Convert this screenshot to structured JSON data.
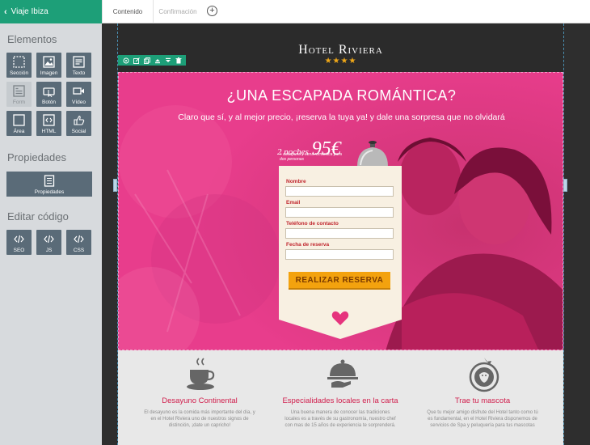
{
  "topbar": {
    "project_label": "Viaje Ibiza",
    "tabs": [
      {
        "label": "Contenido"
      },
      {
        "label": "Confirmación"
      }
    ]
  },
  "sidebar": {
    "elements_title": "Elementos",
    "tools": [
      {
        "label": "Sección",
        "icon": "section-icon"
      },
      {
        "label": "Imagen",
        "icon": "image-icon"
      },
      {
        "label": "Texto",
        "icon": "text-icon"
      },
      {
        "label": "Form",
        "icon": "form-icon"
      },
      {
        "label": "Botón",
        "icon": "button-icon"
      },
      {
        "label": "Vídeo",
        "icon": "video-icon"
      },
      {
        "label": "Área",
        "icon": "area-icon"
      },
      {
        "label": "HTML",
        "icon": "html-icon"
      },
      {
        "label": "Social",
        "icon": "social-icon"
      }
    ],
    "properties_title": "Propiedades",
    "properties_button": "Propiedades",
    "code_title": "Editar código",
    "code_tools": [
      {
        "label": "SEO",
        "icon": "code-icon"
      },
      {
        "label": "JS",
        "icon": "code-icon"
      },
      {
        "label": "CSS",
        "icon": "code-icon"
      }
    ]
  },
  "page": {
    "brand": "Hotel Riviera",
    "stars": "★★★★",
    "hero": {
      "title": "¿UNA ESCAPADA ROMÁNTICA?",
      "subtitle": "Claro que sí, y al mejor precio, ¡reserva la tuya ya! y dale una sorpresa que no olvidará",
      "offer_nights": "2 noches",
      "offer_price": "95€",
      "offer_desc": "+ desayuno y cena romántica para dos personas",
      "form": {
        "fields": [
          {
            "label": "Nombre",
            "value": ""
          },
          {
            "label": "Email",
            "value": ""
          },
          {
            "label": "Teléfono de contacto",
            "value": ""
          },
          {
            "label": "Fecha de reserva",
            "value": ""
          }
        ],
        "submit": "REALIZAR RESERVA"
      }
    },
    "features": [
      {
        "title": "Desayuno Continental",
        "desc": "El desayuno es la comida más importante del día, y en el Hotel Riviera uno de nuestros signos de distinción, ¡date un capricho!",
        "icon": "coffee-cup-icon"
      },
      {
        "title": "Especialidades locales en la carta",
        "desc": "Una buena manera de conocer las tradiciones locales es a través de su gastronomía, nuestro chef con mas de 15 años de experiencia te sorprenderá.",
        "icon": "food-cloche-icon"
      },
      {
        "title": "Trae tu mascota",
        "desc": "Que tu mejor amigo disfrute del Hotel tanto como tú es fundamental, en el Hotel Riviera disponemos de servicios de Spa y peluquería para tus mascotas",
        "icon": "pet-badge-icon"
      }
    ]
  },
  "colors": {
    "accent": "#1d9f78",
    "sidebar_bg": "#d7dadd",
    "tool_bg": "#5a6b78",
    "hero_pink": "#e63a8b",
    "cta_orange": "#f3a20e",
    "feature_title": "#d1204e"
  }
}
